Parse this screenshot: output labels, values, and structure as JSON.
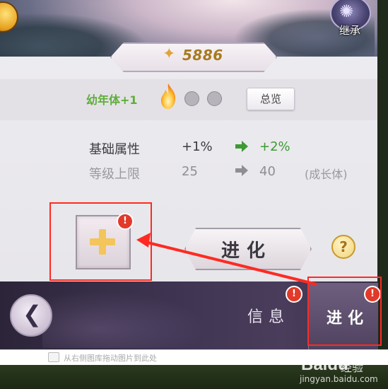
{
  "header": {
    "inherit_label": "继承",
    "score": "5886"
  },
  "stage": {
    "label": "幼年体+1",
    "overview_button": "总览"
  },
  "attributes": [
    {
      "label": "基础属性",
      "current": "+1%",
      "next": "+2%"
    },
    {
      "label": "等级上限",
      "current": "25",
      "next": "40",
      "note": "(成长体)"
    }
  ],
  "actions": {
    "evolve_main": "进化",
    "help": "?",
    "alert_mark": "!"
  },
  "nav": {
    "info_tab": "信息",
    "evolve_tab": "进化"
  },
  "footer": {
    "drag_hint": "从右侧图库拖动图片到此处"
  },
  "watermark": {
    "brand": "Baidu",
    "suffix": "经验",
    "url": "jingyan.baidu.com"
  },
  "colors": {
    "highlight": "#ff2a22",
    "positive": "#3d9a35",
    "stage_green": "#5fae3a",
    "score_gold": "#a87a1e"
  }
}
